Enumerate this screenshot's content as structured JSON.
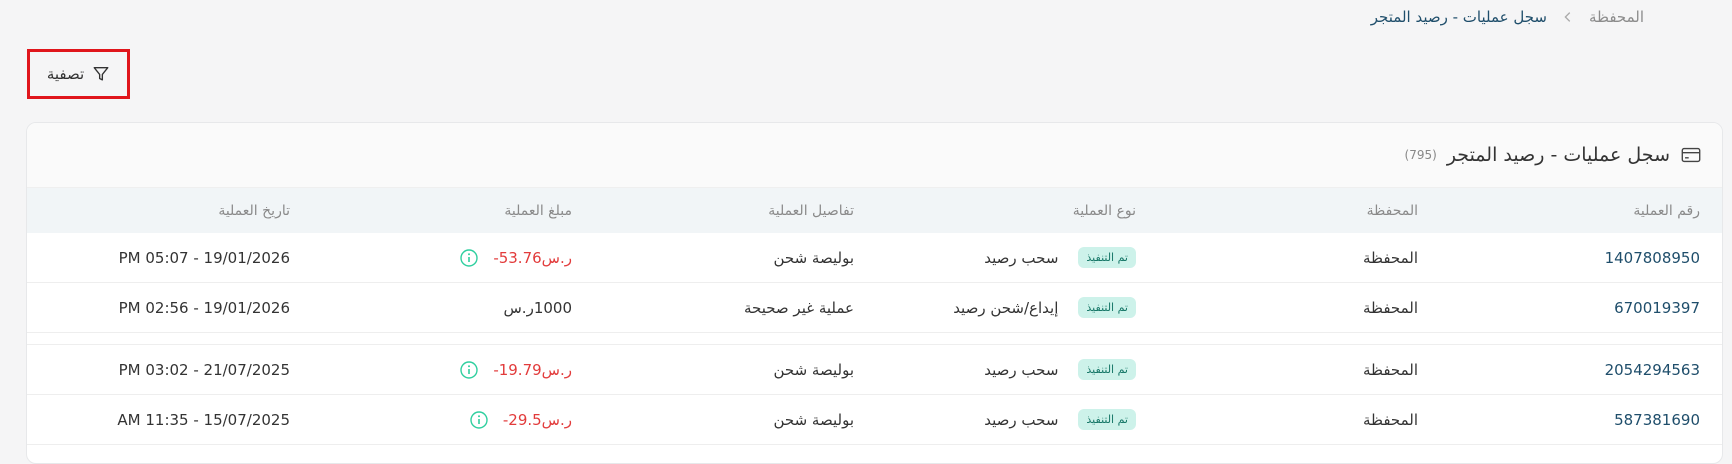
{
  "breadcrumb": {
    "root": "المحفظة",
    "current": "سجل عمليات - رصيد المتجر"
  },
  "filter": {
    "label": "تصفية",
    "highlight_color": "#e0161c"
  },
  "card": {
    "title": "سجل عمليات - رصيد المتجر",
    "count": "(795)"
  },
  "table": {
    "headers": {
      "number": "رقم العملية",
      "wallet": "المحفظة",
      "type": "نوع العملية",
      "details": "تفاصيل العملية",
      "amount": "مبلغ العملية",
      "date": "تاريخ العملية"
    },
    "rows": [
      {
        "number": "1407808950",
        "wallet": "المحفظة",
        "status": "تم التنفيذ",
        "type": "سحب رصيد",
        "details": "بوليصة شحن",
        "amount": "-53.76ر.س",
        "negative": true,
        "info_icon": "info-icon",
        "date": "PM 05:07 - 19/01/2026"
      },
      {
        "number": "670019397",
        "wallet": "المحفظة",
        "status": "تم التنفيذ",
        "type": "إيداع/شحن رصيد",
        "details": "عملية غير صحيحة",
        "amount": "1000ر.س",
        "negative": false,
        "date": "PM 02:56 - 19/01/2026"
      },
      {
        "number": "2054294563",
        "wallet": "المحفظة",
        "status": "تم التنفيذ",
        "type": "سحب رصيد",
        "details": "بوليصة شحن",
        "amount": "-19.79ر.س",
        "negative": true,
        "info_icon": "info-icon",
        "date": "PM 03:02 - 21/07/2025"
      },
      {
        "number": "587381690",
        "wallet": "المحفظة",
        "status": "تم التنفيذ",
        "type": "سحب رصيد",
        "details": "بوليصة شحن",
        "amount": "-29.5ر.س",
        "negative": true,
        "info_icon": "info-icon",
        "date": "AM 11:35 - 15/07/2025"
      }
    ]
  },
  "colors": {
    "link": "#1f4e6b",
    "negative": "#e23b3b",
    "badge_bg": "#cdf2ea",
    "badge_text": "#177868",
    "info_icon": "#2fcf9f"
  }
}
